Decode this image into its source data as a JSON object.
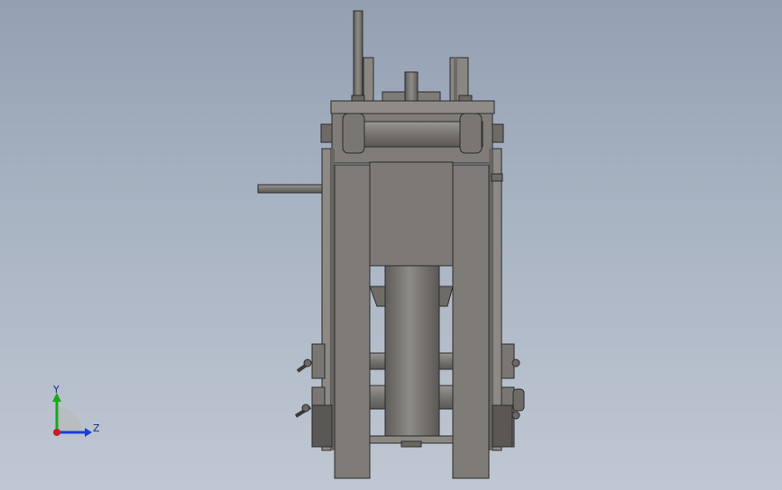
{
  "viewport": {
    "background_top": "#93a0b2",
    "background_bottom": "#bfc7d2",
    "part_color": "#7e7b77",
    "part_dark": "#55524f",
    "part_light": "#9b9894",
    "edge_color": "#2b2b2b"
  },
  "triad": {
    "y_label": "Y",
    "z_label": "Z",
    "y_color": "#1aa81a",
    "z_color": "#1a3fd6",
    "origin_color": "#c81e1e"
  }
}
